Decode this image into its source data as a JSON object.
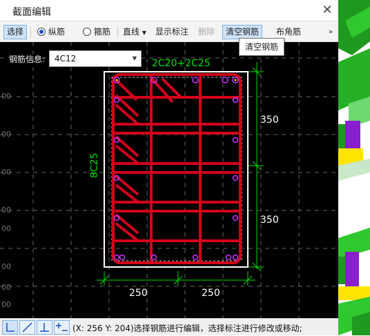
{
  "window": {
    "title": "截面编辑"
  },
  "toolbar": {
    "select_label": "选择",
    "long_bar_label": "纵筋",
    "stirrup_label": "箍筋",
    "line_label": "直线",
    "show_dim_label": "显示标注",
    "delete_label": "删除",
    "clear_label": "清空钢筋",
    "corner_label": "布角筋",
    "overflow_icon": "double-chevron-right-icon"
  },
  "tooltip": {
    "text": "清空钢筋"
  },
  "rebar_info": {
    "label": "钢筋信息:",
    "value": "4C12"
  },
  "drawing": {
    "top_rebar": "2C20+2C25",
    "side_rebar": "8C25",
    "dim_right_upper": "350",
    "dim_right_lower": "350",
    "dim_bottom_left": "250",
    "dim_bottom_right": "250",
    "grid_labels": [
      "00",
      "00",
      "00",
      "00",
      "00",
      "00",
      "00",
      "00"
    ],
    "colors": {
      "rebar": "#d4001a",
      "dimension": "#00e000",
      "section": "#ffffff",
      "bar_dot": "#cc33ff"
    }
  },
  "statusbar": {
    "text": "(X: 256 Y: 204)选择钢筋进行编辑，选择标注进行修改或移动;"
  }
}
